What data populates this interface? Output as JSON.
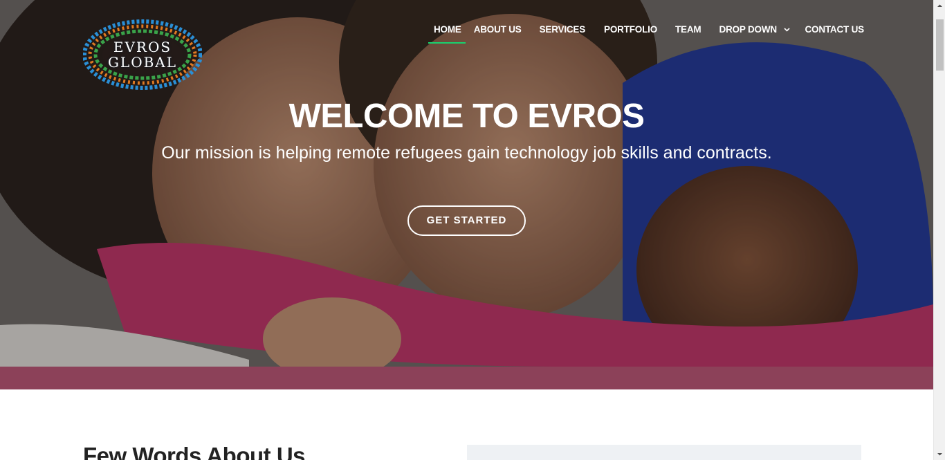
{
  "logo": {
    "line1": "EVROS",
    "line2": "GLOBAL"
  },
  "nav": {
    "home": "HOME",
    "about": "ABOUT US",
    "services": "SERVICES",
    "portfolio": "PORTFOLIO",
    "team": "TEAM",
    "dropdown": "DROP DOWN",
    "contact": "CONTACT US",
    "active": "HOME",
    "dropdown_icon": "chevron-down-icon"
  },
  "hero": {
    "title": "WELCOME TO EVROS",
    "subtitle": "Our mission is helping remote refugees gain technology job skills and contracts.",
    "button": "GET STARTED",
    "image": "photo of three smiling children"
  },
  "about": {
    "title": "Few Words About Us"
  },
  "colors": {
    "accent": "#18d26e",
    "text_dark": "#222222",
    "white": "#ffffff"
  }
}
